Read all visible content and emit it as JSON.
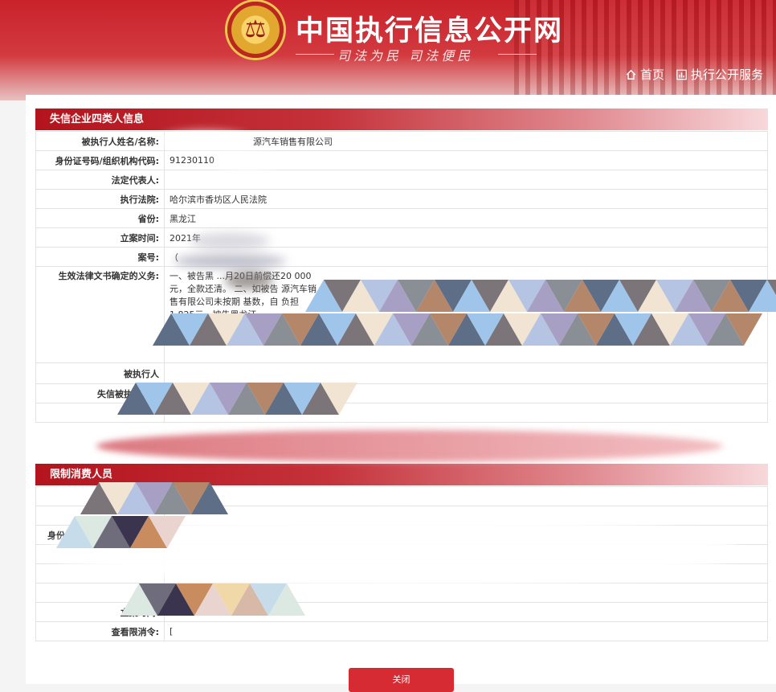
{
  "site": {
    "title": "中国执行信息公开网",
    "slogan": "司法为民  司法便民",
    "nav": [
      {
        "label": "首页",
        "icon": "home-icon"
      },
      {
        "label": "执行公开服务",
        "icon": "chart-icon"
      }
    ]
  },
  "sections": [
    {
      "title": "失信企业四类人信息",
      "rows": [
        {
          "label": "被执行人姓名/名称:",
          "value": "源汽车销售有限公司"
        },
        {
          "label": "身份证号码/组织机构代码:",
          "value": "91230110"
        },
        {
          "label": "法定代表人:",
          "value": ""
        },
        {
          "label": "执行法院:",
          "value": "哈尔滨市香坊区人民法院"
        },
        {
          "label": "省份:",
          "value": "黑龙江"
        },
        {
          "label": "立案时间:",
          "value": "2021年"
        },
        {
          "label": "案号:",
          "value": "（"
        },
        {
          "label": "生效法律文书确定的义务:",
          "value": "一、被告黑 ...月20日前偿还20 000元，全款还清。 二、如被告 源汽车销售有限公司未按期 基数，自 负担1,825元，被告黑龙江"
        },
        {
          "label": "被执行人",
          "value": ""
        },
        {
          "label": "失信被执行人行",
          "value": ""
        },
        {
          "label": "",
          "value": ""
        }
      ]
    },
    {
      "title": "限制消费人员",
      "rows": [
        {
          "label": "",
          "value": ""
        },
        {
          "label": "",
          "value": ""
        },
        {
          "label": "身份",
          "value": ""
        },
        {
          "label": "",
          "value": ""
        },
        {
          "label": "",
          "value": ""
        },
        {
          "label": "案号:",
          "value": ""
        },
        {
          "label": "立案时间:",
          "value": ""
        },
        {
          "label": "查看限消令:",
          "value": "["
        }
      ]
    }
  ],
  "actions": {
    "close_label": "关闭"
  },
  "colors": {
    "brand_red": "#c9222b",
    "button_red": "#d62b33"
  }
}
